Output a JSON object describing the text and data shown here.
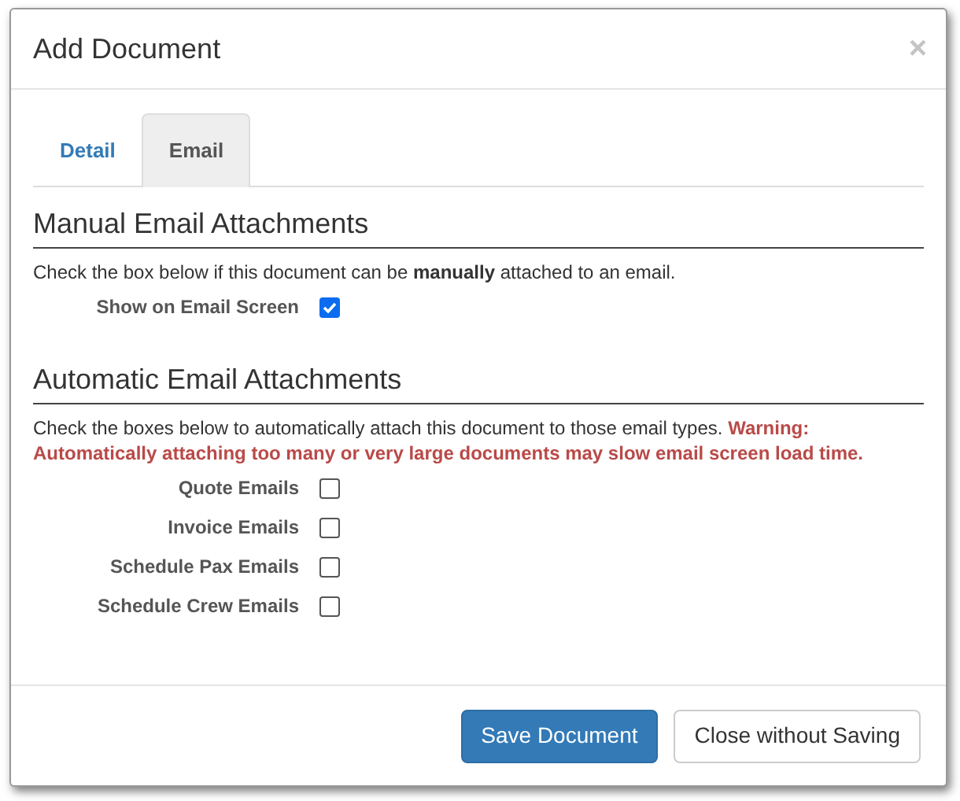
{
  "dialog": {
    "title": "Add Document",
    "close": "×"
  },
  "tabs": [
    {
      "label": "Detail",
      "selected": false
    },
    {
      "label": "Email",
      "selected": true
    }
  ],
  "sections": [
    {
      "heading": "Manual Email Attachments",
      "description": "Check the box below if this document can be **manually** attached to an email.",
      "options": [
        {
          "label": "Show on Email Screen",
          "checked": true
        }
      ]
    },
    {
      "heading": "Automatic Email Attachments",
      "description": "Check the boxes below to automatically attach this document to those email types.",
      "warning": "Warning: Automatically attaching too many or very large documents may slow email screen load time.",
      "options": [
        {
          "label": "Quote Emails",
          "checked": false
        },
        {
          "label": "Invoice Emails",
          "checked": false
        },
        {
          "label": "Schedule Pax Emails",
          "checked": false
        },
        {
          "label": "Schedule Crew Emails",
          "checked": false
        }
      ]
    }
  ],
  "buttons": [
    {
      "label": "Save Document",
      "kind": "primary"
    },
    {
      "label": "Close without Saving",
      "kind": "default"
    }
  ]
}
